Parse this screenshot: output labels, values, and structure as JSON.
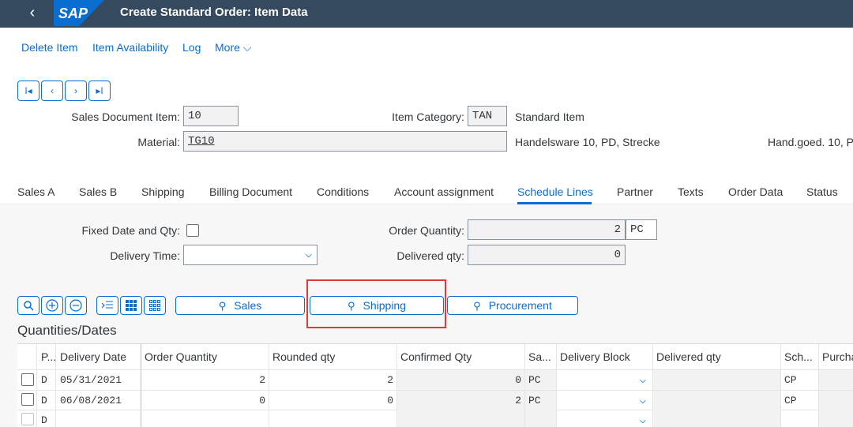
{
  "shell": {
    "back_icon": "‹",
    "logo_text": "SAP",
    "title": "Create Standard Order: Item Data"
  },
  "actions": [
    "Delete Item",
    "Item Availability",
    "Log",
    "More"
  ],
  "nav_buttons": [
    "I◂",
    "‹",
    "›",
    "▸I"
  ],
  "header": {
    "sales_doc_item_label": "Sales Document Item:",
    "sales_doc_item_value": "10",
    "item_category_label": "Item Category:",
    "item_category_value": "TAN",
    "item_category_desc": "Standard Item",
    "material_label": "Material:",
    "material_value": "TG10",
    "material_desc": "Handelsware 10, PD, Strecke",
    "material_desc2": "Hand.goed. 10, P"
  },
  "tabs": [
    "Sales A",
    "Sales B",
    "Shipping",
    "Billing Document",
    "Conditions",
    "Account assignment",
    "Schedule Lines",
    "Partner",
    "Texts",
    "Order Data",
    "Status"
  ],
  "active_tab": "Schedule Lines",
  "schedule": {
    "fixed_date_label": "Fixed Date and Qty:",
    "delivery_time_label": "Delivery Time:",
    "delivery_time_value": "",
    "order_qty_label": "Order Quantity:",
    "order_qty_value": "2",
    "order_qty_unit": "PC",
    "delivered_qty_label": "Delivered qty:",
    "delivered_qty_value": "0"
  },
  "table_tools": {
    "sales": "Sales",
    "shipping": "Shipping",
    "procurement": "Procurement"
  },
  "section_title": "Quantities/Dates",
  "grid": {
    "columns": [
      "P...",
      "Delivery Date",
      "Order Quantity",
      "Rounded qty",
      "Confirmed Qty",
      "Sa...",
      "Delivery Block",
      "Delivered qty",
      "Sch...",
      "Purcha"
    ],
    "rows": [
      {
        "p": "D",
        "date": "05/31/2021",
        "order_qty": "2",
        "rounded": "2",
        "confirmed": "0",
        "unit": "PC",
        "block": "",
        "delivered": "",
        "sch": "CP"
      },
      {
        "p": "D",
        "date": "06/08/2021",
        "order_qty": "0",
        "rounded": "0",
        "confirmed": "2",
        "unit": "PC",
        "block": "",
        "delivered": "",
        "sch": "CP"
      },
      {
        "p": "D",
        "date": "",
        "order_qty": "",
        "rounded": "",
        "confirmed": "",
        "unit": "",
        "block": "",
        "delivered": "",
        "sch": ""
      }
    ]
  },
  "colors": {
    "shell": "#354a5f",
    "accent": "#0a6ed1",
    "highlight": "#e03a3a"
  }
}
